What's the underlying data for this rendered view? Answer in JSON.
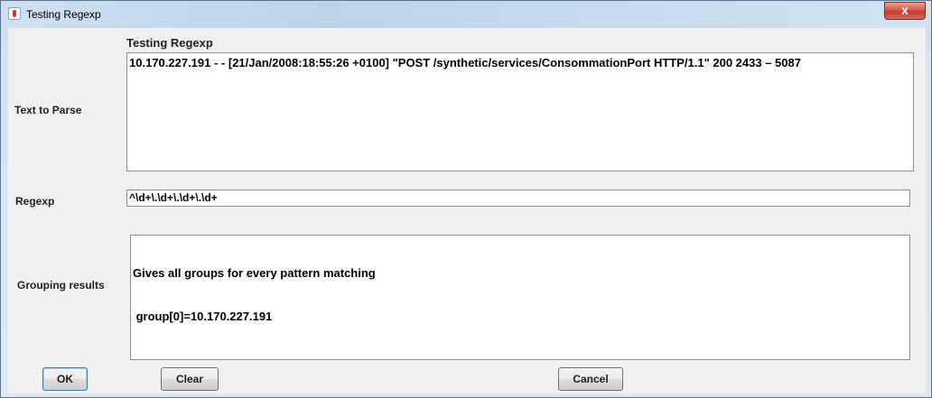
{
  "window": {
    "title": "Testing Regexp",
    "close_glyph": "x",
    "icon": "java-cup-icon"
  },
  "form": {
    "heading": "Testing Regexp",
    "text_to_parse_label": "Text to Parse",
    "text_to_parse_value": "10.170.227.191 - - [21/Jan/2008:18:55:26 +0100] \"POST /synthetic/services/ConsommationPort HTTP/1.1\" 200 2433 – 5087",
    "regexp_label": "Regexp",
    "regexp_value": "^\\d+\\.\\d+\\.\\d+\\.\\d+",
    "grouping_label": "Grouping results",
    "grouping_lines": [
      "Gives all groups for every pattern matching",
      " group[0]=10.170.227.191"
    ]
  },
  "buttons": {
    "ok": "OK",
    "clear": "Clear",
    "cancel": "Cancel"
  }
}
